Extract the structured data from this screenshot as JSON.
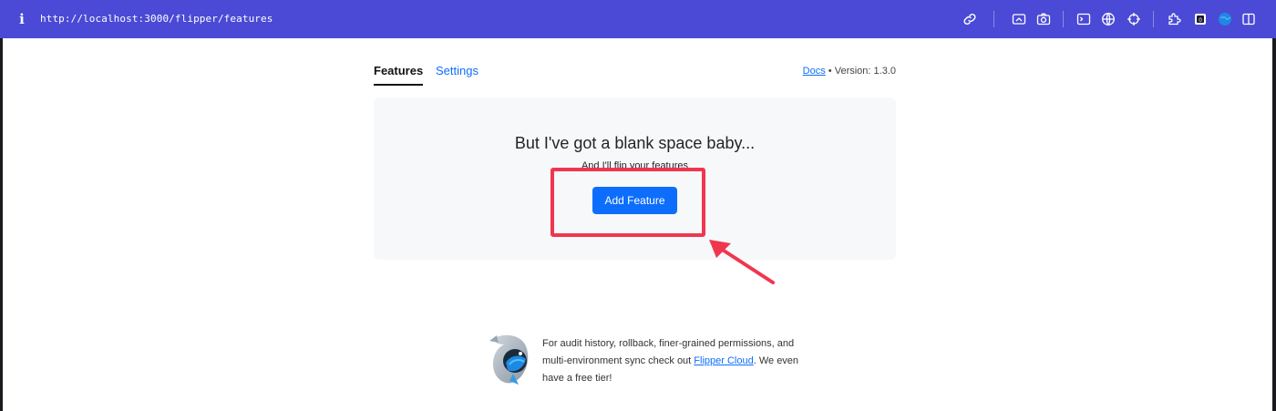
{
  "browser": {
    "info_icon": "info-icon",
    "url": "http://localhost:3000/flipper/features",
    "toolbar_icons": [
      "link-icon",
      "screenshot-icon",
      "camera-icon",
      "terminal-icon",
      "globe-icon",
      "crosshair-icon",
      "extension-icon",
      "profile-icon",
      "globe-blue-icon",
      "sidebar-icon"
    ]
  },
  "nav": {
    "tabs": [
      {
        "label": "Features",
        "active": true
      },
      {
        "label": "Settings",
        "active": false
      }
    ],
    "docs_label": "Docs",
    "separator": "•",
    "version": "Version: 1.3.0"
  },
  "empty_state": {
    "title": "But I've got a blank space baby...",
    "subtitle": "And I'll flip your features",
    "add_button_label": "Add Feature"
  },
  "promo": {
    "text_before": "For audit history, rollback, finer-grained permissions, and multi-environment sync check out ",
    "link_label": "Flipper Cloud",
    "text_after": ". We even have a free tier!"
  },
  "colors": {
    "topbar": "#4a4ad6",
    "primary": "#0d6efd",
    "annotation": "#f0364f",
    "card_bg": "#f7f8fa"
  }
}
